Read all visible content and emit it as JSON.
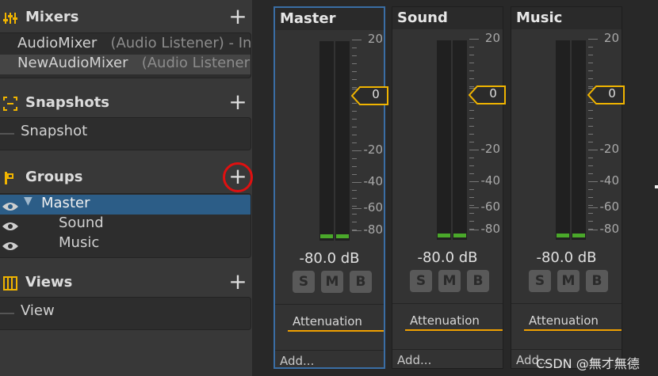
{
  "sections": {
    "mixers": {
      "title": "Mixers",
      "items": [
        {
          "name": "AudioMixer",
          "detail": "(Audio Listener) - In"
        },
        {
          "name": "NewAudioMixer",
          "detail": "(Audio Listener"
        }
      ]
    },
    "snapshots": {
      "title": "Snapshots",
      "items": [
        {
          "name": "Snapshot"
        }
      ]
    },
    "groups": {
      "title": "Groups",
      "items": [
        {
          "name": "Master"
        },
        {
          "name": "Sound"
        },
        {
          "name": "Music"
        }
      ]
    },
    "views": {
      "title": "Views",
      "items": [
        {
          "name": "View"
        }
      ]
    }
  },
  "scale_labels": [
    "20",
    "-20",
    "-40",
    "-60",
    "-80"
  ],
  "strips": [
    {
      "name": "Master",
      "level": "-80.0 dB",
      "fader_value": "0",
      "buttons": [
        "S",
        "M",
        "B"
      ],
      "effect": "Attenuation",
      "add": "Add..."
    },
    {
      "name": "Sound",
      "level": "-80.0 dB",
      "fader_value": "0",
      "buttons": [
        "S",
        "M",
        "B"
      ],
      "effect": "Attenuation",
      "add": "Add..."
    },
    {
      "name": "Music",
      "level": "-80.0 dB",
      "fader_value": "0",
      "buttons": [
        "S",
        "M",
        "B"
      ],
      "effect": "Attenuation",
      "add": "Add..."
    }
  ],
  "watermark": "CSDN @無才無德",
  "colors": {
    "accent": "#f0b400",
    "selection": "#2c5d87",
    "meter_green": "#4aa82a",
    "highlight_circle": "#e01010"
  }
}
